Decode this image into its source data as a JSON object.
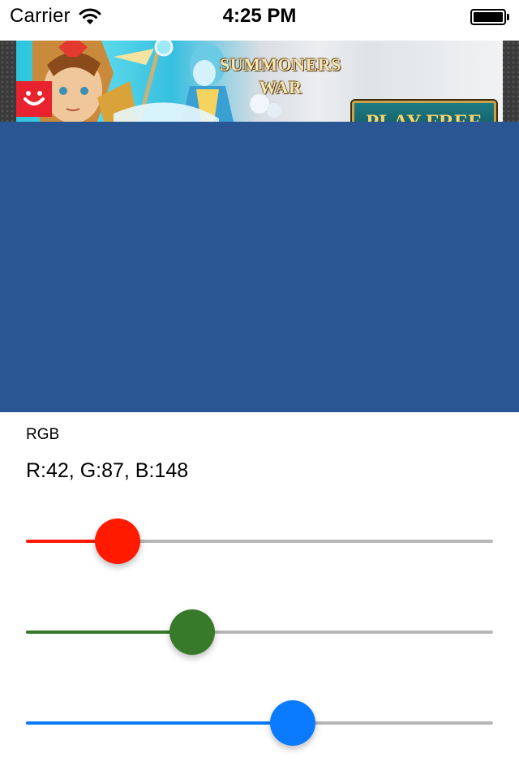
{
  "status_bar": {
    "carrier": "Carrier",
    "time": "4:25 PM",
    "icons": [
      "wifi-icon",
      "battery-icon"
    ]
  },
  "ad": {
    "title": "SUMMONERS WAR",
    "cta_label": "PLAY FREE",
    "info_icon": "info-icon"
  },
  "color": {
    "r": 42,
    "g": 87,
    "b": 148,
    "hex": "#2A5794"
  },
  "panel": {
    "heading": "RGB",
    "value_text": "R:42, G:87, B:148"
  },
  "sliders": [
    {
      "channel": "R",
      "value": 42,
      "max": 255,
      "color": "#FF1A00",
      "fill_fraction": 0.197
    },
    {
      "channel": "G",
      "value": 87,
      "max": 255,
      "color": "#367A2A",
      "fill_fraction": 0.356
    },
    {
      "channel": "B",
      "value": 148,
      "max": 255,
      "color": "#0A7BFF",
      "fill_fraction": 0.571
    }
  ],
  "track_color": "#B6B6B6"
}
